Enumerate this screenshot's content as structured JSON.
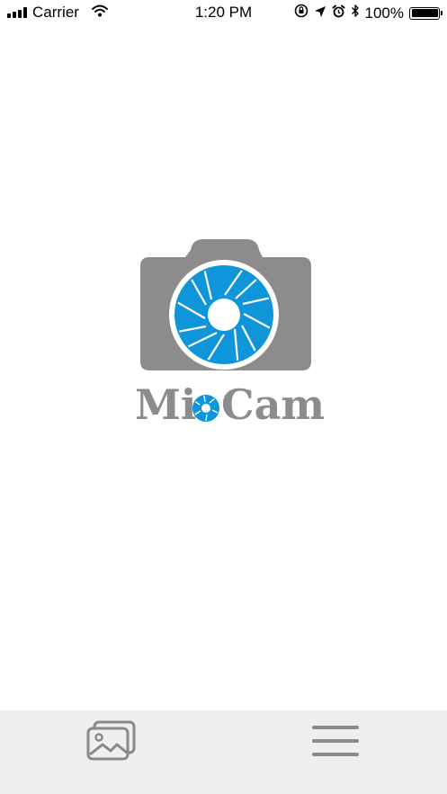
{
  "status_bar": {
    "carrier": "Carrier",
    "time": "1:20 PM",
    "battery_percent": "100%",
    "battery_level": 1.0,
    "icons": [
      "signal-icon",
      "wifi-icon",
      "orientation-lock-icon",
      "location-icon",
      "alarm-icon",
      "bluetooth-icon",
      "battery-icon"
    ]
  },
  "logo": {
    "text_before": "Mi",
    "text_after": "Cam",
    "colors": {
      "gray": "#8c8c8c",
      "blue": "#0f95d9"
    }
  },
  "bottom_bar": {
    "background": "#efefef",
    "buttons": [
      {
        "name": "gallery-button",
        "icon": "gallery-icon"
      },
      {
        "name": "menu-button",
        "icon": "hamburger-menu-icon"
      }
    ]
  }
}
